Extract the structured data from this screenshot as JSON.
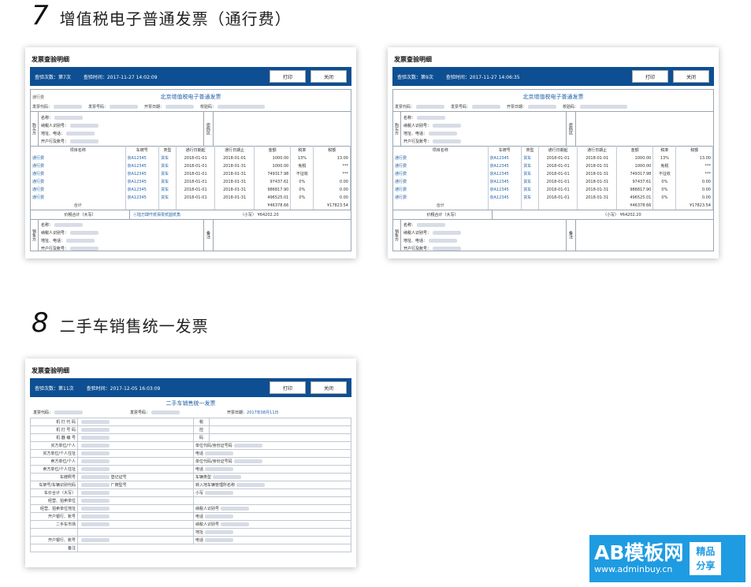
{
  "sections": {
    "s7": {
      "num": "7",
      "text": "增值税电子普通发票（通行费）"
    },
    "s8": {
      "num": "8",
      "text": "二手车销售统一发票"
    }
  },
  "common": {
    "card_title": "发票查验明细",
    "print": "打印",
    "close": "关闭",
    "accent": "#0d4f92"
  },
  "card1": {
    "count": "查验次数：第7次",
    "time": "查验时间：2017-11-27 14:02:09"
  },
  "card2": {
    "count": "查验次数：第9次",
    "time": "查验时间：2017-11-27 14:06:35"
  },
  "card3": {
    "count": "查验次数：第11次",
    "time": "查验时间：2017-12-05 16:03:09"
  },
  "toll": {
    "type_label": "通行费",
    "title": "北京增值税电子普通发票",
    "code_label": "发票代码：",
    "num_label": "发票号码：",
    "date_label": "开票日期：",
    "check_label": "校验码：",
    "buyer_side": "购买方",
    "seller_side": "销售方",
    "pw_label": "密码区",
    "remark_label": "备注",
    "party_fields": [
      "名称：",
      "纳税人识别号：",
      "地址、电话：",
      "开户行及账号："
    ],
    "columns": [
      "项目名称",
      "车牌号",
      "类型",
      "通行日期起",
      "通行日期止",
      "金额",
      "税率",
      "税额"
    ],
    "rows": [
      [
        "通行费",
        "京A12345",
        "货车",
        "2018-01-01",
        "2018-01-01",
        "1000.00",
        "13%",
        "13.00"
      ],
      [
        "通行费",
        "京A12345",
        "货车",
        "2018-01-01",
        "2018-01-31",
        "1000.00",
        "免税",
        "***"
      ],
      [
        "通行费",
        "京A12345",
        "货车",
        "2018-01-01",
        "2018-01-31",
        "749317.98",
        "不征收",
        "***"
      ],
      [
        "通行费",
        "京A12345",
        "货车",
        "2018-01-01",
        "2018-01-31",
        "97437.61",
        "0%",
        "0.00"
      ],
      [
        "通行费",
        "京A12345",
        "货车",
        "2018-01-01",
        "2018-01-31",
        "986817.90",
        "0%",
        "0.00"
      ],
      [
        "通行费",
        "京A12345",
        "货车",
        "2018-01-01",
        "2018-01-31",
        "496525.01",
        "0%",
        "0.00"
      ]
    ],
    "sum_label": "合计",
    "sum_amount": "¥46378.66",
    "sum_tax": "¥17823.54",
    "total_label": "价税合计（大写）",
    "total_caps": "ⓧ陆万肆仟贰佰零贰圆贰角",
    "total_small": "（小写）  ¥64202.20"
  },
  "used": {
    "title": "二手车销售统一发票",
    "code_label": "发票代码：",
    "num_label": "发票号码：",
    "date_label": "开票日期：",
    "date_value": "2017年08月11日",
    "rows": [
      [
        "机 打 代 码",
        "",
        "税",
        ""
      ],
      [
        "机 打 号 码",
        "",
        "控",
        ""
      ],
      [
        "机 器 编 号",
        "",
        "码",
        ""
      ],
      [
        "买方单位/个人",
        "",
        "单位代码/身份证号码",
        ""
      ],
      [
        "买方单位/个人住址",
        "",
        "电话",
        ""
      ],
      [
        "卖方单位/个人",
        "",
        "单位代码/身份证号码",
        ""
      ],
      [
        "卖方单位/个人住址",
        "",
        "电话",
        ""
      ],
      [
        "车牌照号",
        "登记证号",
        "车辆类型",
        ""
      ],
      [
        "车架号/车辆识别代码",
        "厂牌型号",
        "转入地车辆管理所名称",
        ""
      ],
      [
        "车价合计（大写）",
        "",
        "小写",
        ""
      ],
      [
        "经营、拍卖单位",
        "",
        "",
        ""
      ],
      [
        "经营、拍卖单位地址",
        "",
        "纳税人识别号",
        ""
      ],
      [
        "开户银行、账号",
        "",
        "电话",
        ""
      ],
      [
        "二手车市场",
        "",
        "纳税人识别号",
        ""
      ],
      [
        "",
        "",
        "地址",
        ""
      ],
      [
        "开户银行、账号",
        "",
        "电话",
        ""
      ],
      [
        "备注",
        "",
        "",
        ""
      ]
    ]
  },
  "logo": {
    "brand": "AB模板网",
    "url": "www.adminbuy.cn",
    "badge1": "精品",
    "badge2": "分享"
  }
}
